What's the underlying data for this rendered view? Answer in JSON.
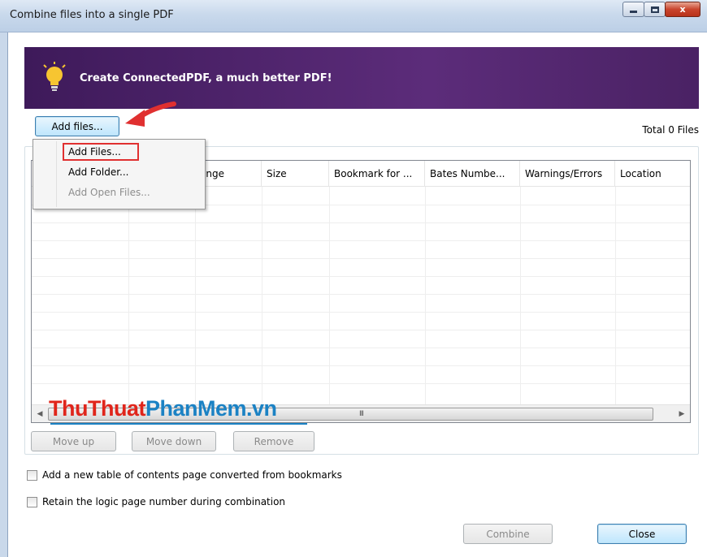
{
  "window": {
    "title": "Combine files into a single PDF",
    "controls": {
      "minimize": "minimize-icon",
      "maximize": "maximize-icon",
      "close": "x"
    }
  },
  "banner": {
    "text": "Create ConnectedPDF, a much better PDF!",
    "icon": "lightbulb-icon"
  },
  "toolbar": {
    "add_files_label": "Add files...",
    "total_label": "Total 0 Files"
  },
  "menu": {
    "items": [
      {
        "label": "Add Files...",
        "enabled": true,
        "highlighted": true
      },
      {
        "label": "Add Folder...",
        "enabled": true
      },
      {
        "label": "Add Open Files...",
        "enabled": false
      }
    ]
  },
  "table": {
    "columns": [
      "",
      "",
      "ange",
      "Size",
      "Bookmark for ...",
      "Bates Numbe...",
      "Warnings/Errors",
      "Location"
    ],
    "scroll_grip": "III"
  },
  "watermark": {
    "part1": "ThuThuat",
    "part2": "PhanMem",
    "part3": ".vn"
  },
  "actions": {
    "move_up": "Move up",
    "move_down": "Move down",
    "remove": "Remove"
  },
  "options": {
    "toc_label": "Add a new table of contents page converted from bookmarks",
    "logic_page_label": "Retain the logic page number during combination"
  },
  "footer": {
    "combine": "Combine",
    "close": "Close"
  },
  "colors": {
    "banner": "#5c2c7a",
    "annotation": "#e03030",
    "watermark_red": "#e0251b",
    "watermark_blue": "#1b82c4"
  }
}
